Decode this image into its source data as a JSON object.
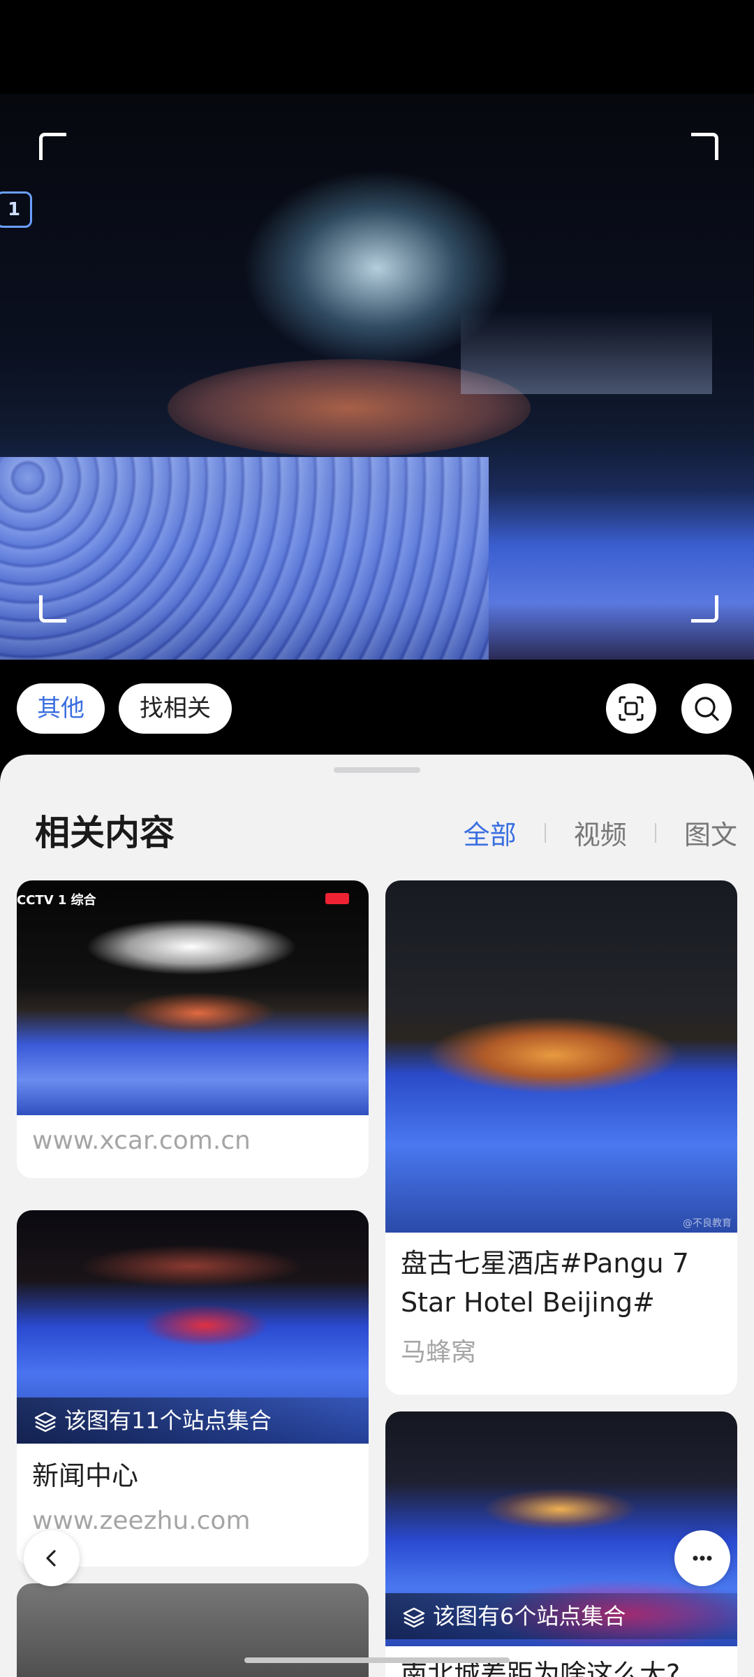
{
  "preview": {
    "channel_badge": "1"
  },
  "toolbar": {
    "tag_other": "其他",
    "tag_find_related": "找相关",
    "crop_icon": "scan-crop-icon",
    "search_icon": "search-icon"
  },
  "sheet": {
    "title": "相关内容",
    "filters": [
      "全部",
      "视频",
      "图文"
    ],
    "active_filter": "全部"
  },
  "results": {
    "left": [
      {
        "source": "www.xcar.com.cn",
        "thumb_text": "CCTV 1 综合"
      },
      {
        "badge": "该图有11个站点集合",
        "headline": "新闻中心",
        "source": "www.zeezhu.com"
      }
    ],
    "right": [
      {
        "headline": "盘古七星酒店#Pangu 7 Star Hotel Beijing#",
        "source": "马蜂窝",
        "watermark": "@不良教育"
      },
      {
        "badge": "该图有6个站点集合",
        "headline": "南北城差距为啥这么大?"
      }
    ]
  },
  "floating": {
    "back_icon": "chevron-left-icon",
    "more_icon": "more-dots-icon"
  },
  "colors": {
    "accent": "#3a6fe0",
    "sheet_bg": "#f2f2f3"
  }
}
